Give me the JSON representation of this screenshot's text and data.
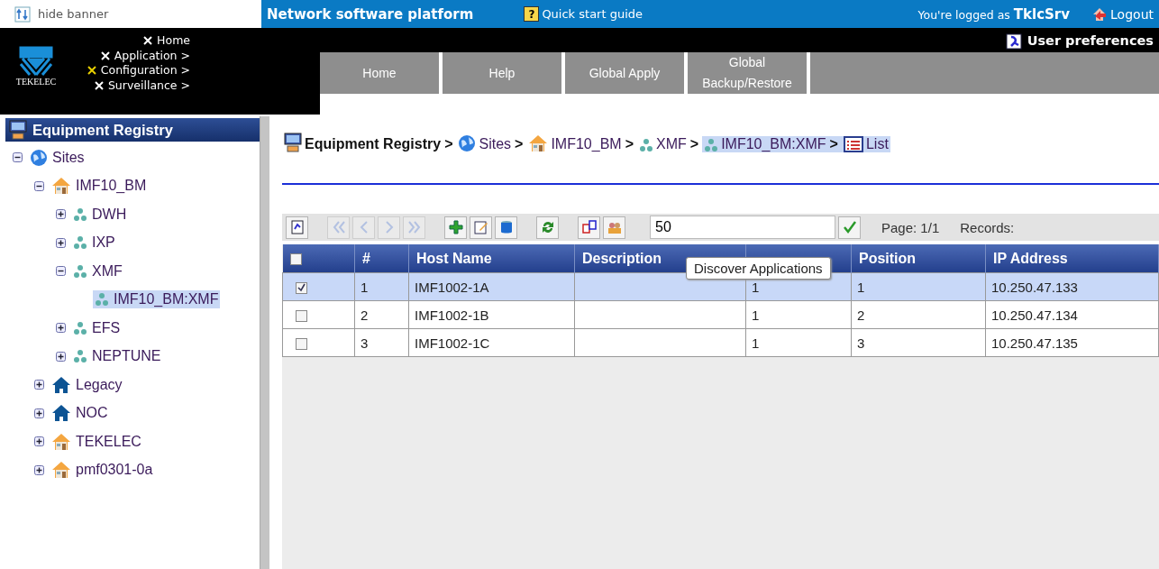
{
  "banner_toggle": {
    "label": "hide banner"
  },
  "topbar": {
    "title": "Network software platform",
    "quick_start": {
      "glyph": "?",
      "label": "Quick start guide"
    },
    "logged_prefix": "You're logged as",
    "user": "TklcSrv",
    "logout": "Logout"
  },
  "logo": {
    "text": "TEKELEC"
  },
  "banner_menu": [
    {
      "label": "Home",
      "selected": false
    },
    {
      "label": "Application >",
      "selected": false
    },
    {
      "label": "Configuration >",
      "selected": true
    },
    {
      "label": "Surveillance >",
      "selected": false
    }
  ],
  "user_preferences": "User preferences",
  "nav_tabs": [
    {
      "label": "Home"
    },
    {
      "label": "Help"
    },
    {
      "label": "Global Apply"
    },
    {
      "label": "Global Backup/Restore"
    }
  ],
  "sidebar": {
    "title": "Equipment Registry",
    "tree": [
      {
        "label": "Sites",
        "kind": "globe",
        "expanded": true,
        "selected": false,
        "children": [
          {
            "label": "IMF10_BM",
            "kind": "house",
            "expanded": true,
            "selected": false,
            "children": [
              {
                "label": "DWH",
                "kind": "cluster",
                "expanded": false,
                "selected": false
              },
              {
                "label": "IXP",
                "kind": "cluster",
                "expanded": false,
                "selected": false
              },
              {
                "label": "XMF",
                "kind": "cluster",
                "expanded": true,
                "selected": false,
                "children": [
                  {
                    "label": "IMF10_BM:XMF",
                    "kind": "cluster",
                    "selected": true
                  }
                ]
              },
              {
                "label": "EFS",
                "kind": "cluster",
                "expanded": false,
                "selected": false
              },
              {
                "label": "NEPTUNE",
                "kind": "cluster",
                "expanded": false,
                "selected": false
              }
            ]
          },
          {
            "label": "Legacy",
            "kind": "house_blue",
            "expanded": false,
            "selected": false
          },
          {
            "label": "NOC",
            "kind": "house_blue",
            "expanded": false,
            "selected": false
          },
          {
            "label": "TEKELEC",
            "kind": "house",
            "expanded": false,
            "selected": false
          },
          {
            "label": "pmf0301-0a",
            "kind": "house",
            "expanded": false,
            "selected": false
          }
        ]
      }
    ]
  },
  "breadcrumb": [
    {
      "label": "Equipment Registry",
      "kind": "server",
      "sep": ">",
      "selected": false
    },
    {
      "label": "Sites",
      "kind": "globe",
      "sep": ">",
      "selected": false
    },
    {
      "label": "IMF10_BM",
      "kind": "house",
      "sep": ">",
      "selected": false
    },
    {
      "label": "XMF",
      "kind": "cluster",
      "sep": ">",
      "selected": false
    },
    {
      "label": "IMF10_BM:XMF",
      "kind": "cluster",
      "sep": ">",
      "selected": true
    },
    {
      "label": "List",
      "kind": "list",
      "selected": true
    }
  ],
  "toolbar": {
    "buttons": [
      {
        "kind": "export",
        "disabled": false
      },
      {
        "kind": "first",
        "disabled": true
      },
      {
        "kind": "prev",
        "disabled": true
      },
      {
        "kind": "next",
        "disabled": true
      },
      {
        "kind": "last",
        "disabled": true
      },
      {
        "kind": "add",
        "disabled": false
      },
      {
        "kind": "edit",
        "disabled": false
      },
      {
        "kind": "database",
        "disabled": false
      },
      {
        "kind": "refresh",
        "disabled": false
      },
      {
        "kind": "transfer",
        "disabled": false
      },
      {
        "kind": "discover",
        "disabled": false
      }
    ],
    "page_size": "50",
    "page": "Page: 1/1",
    "records": "Records:"
  },
  "tooltip": "Discover Applications",
  "table": {
    "all_checked": false,
    "columns": [
      "#",
      "Host Name",
      "Description",
      null,
      "Position",
      "IP Address"
    ],
    "rows": [
      {
        "checked": true,
        "selected": true,
        "cells": [
          "1",
          "IMF1002-1A",
          "",
          "1",
          "1",
          "10.250.47.133"
        ]
      },
      {
        "checked": false,
        "selected": false,
        "cells": [
          "2",
          "IMF1002-1B",
          "",
          "1",
          "2",
          "10.250.47.134"
        ]
      },
      {
        "checked": false,
        "selected": false,
        "cells": [
          "3",
          "IMF1002-1C",
          "",
          "1",
          "3",
          "10.250.47.135"
        ]
      }
    ]
  }
}
